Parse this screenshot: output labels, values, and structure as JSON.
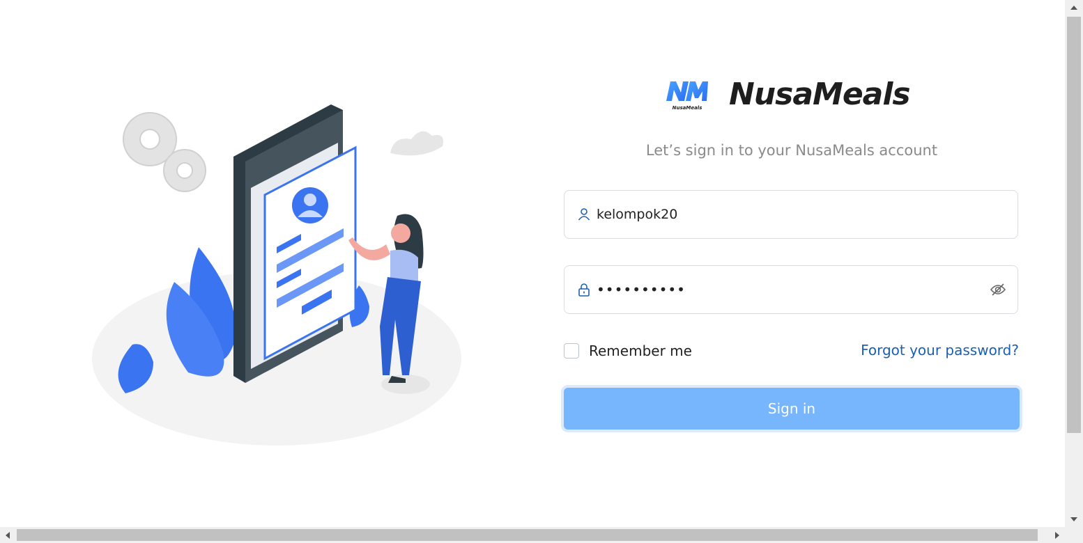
{
  "brand": {
    "name": "NusaMeals",
    "logo_caption": "NusaMeals",
    "logo_letters": "NM"
  },
  "subtitle": "Let’s sign in to your NusaMeals account",
  "form": {
    "username_value": "kelompok20",
    "password_value": "••••••••••",
    "remember_label": "Remember me",
    "forgot_link": "Forgot your password?",
    "signin_label": "Sign in"
  },
  "icons": {
    "username": "user-icon",
    "password": "lock-icon",
    "toggle": "eye-slash-icon"
  },
  "colors": {
    "accent_blue": "#3b74f0",
    "button_bg": "#77b5fc",
    "link": "#1a5fb4",
    "icon": "#1a5fb4"
  }
}
